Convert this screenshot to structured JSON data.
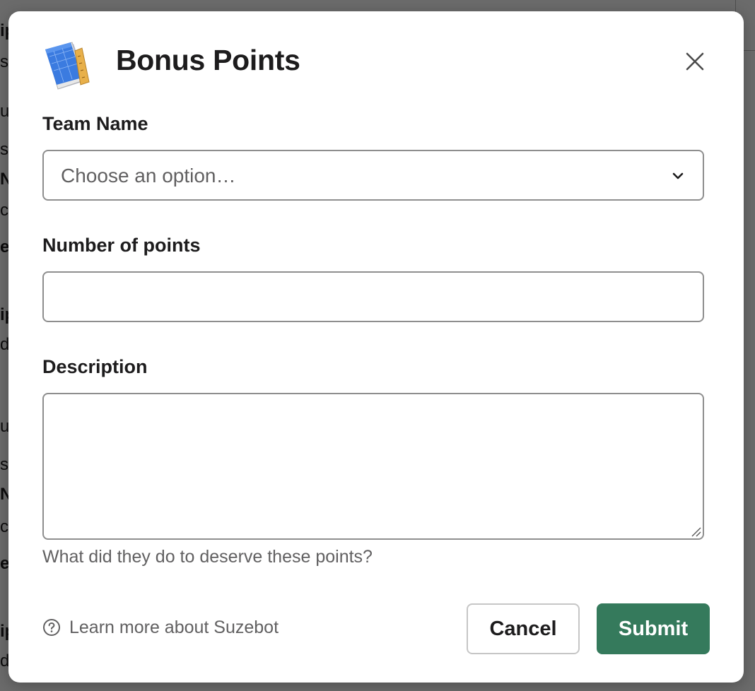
{
  "background": {
    "fragments": [
      {
        "text": "ip",
        "bold": true
      },
      {
        "text": "sc",
        "bold": false
      },
      {
        "text": "ul",
        "bold": false
      },
      {
        "text": "s",
        "bold": false
      },
      {
        "text": "N",
        "bold": true
      },
      {
        "text": "ce",
        "bold": false
      },
      {
        "text": "e",
        "bold": true
      },
      {
        "text": "ip",
        "bold": true
      },
      {
        "text": "ds",
        "bold": false
      },
      {
        "text": "ul",
        "bold": false
      },
      {
        "text": "s",
        "bold": false
      },
      {
        "text": "N",
        "bold": true
      },
      {
        "text": "ce",
        "bold": false
      },
      {
        "text": "e",
        "bold": true
      },
      {
        "text": "ip",
        "bold": true
      },
      {
        "text": "ds",
        "bold": false
      }
    ]
  },
  "modal": {
    "title": "Bonus Points",
    "app_icon": "blueprint-book-icon",
    "close_icon": "close-icon",
    "fields": {
      "team_name": {
        "label": "Team Name",
        "placeholder": "Choose an option…",
        "icon": "chevron-down-icon"
      },
      "points": {
        "label": "Number of points",
        "value": ""
      },
      "description": {
        "label": "Description",
        "value": "",
        "hint": "What did they do to deserve these points?"
      }
    },
    "footer": {
      "help_link": "Learn more about Suzebot",
      "help_icon": "question-circle-icon",
      "cancel_label": "Cancel",
      "submit_label": "Submit"
    }
  },
  "colors": {
    "submit_bg": "#357a5c",
    "text_primary": "#1d1c1d",
    "text_muted": "#616061",
    "border": "#8e8e8e"
  }
}
